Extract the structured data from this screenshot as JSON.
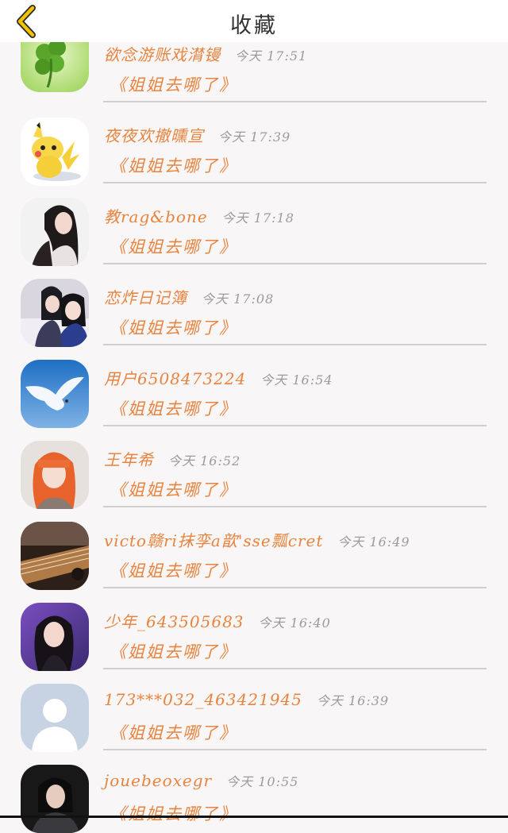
{
  "header": {
    "title": "收藏",
    "back_icon": "chevron-left-icon",
    "accent": "#f2c200"
  },
  "colors": {
    "name": "#e8843f",
    "time": "#9b9b9b",
    "background": "#f8f6f7"
  },
  "favorites": [
    {
      "name": "欲念游账戏潸镘",
      "day": "今天",
      "time": "17:51",
      "message": "《姐姐去哪了》",
      "avatar": "clover"
    },
    {
      "name": "夜夜欢撤曛宣",
      "day": "今天",
      "time": "17:39",
      "message": "《姐姐去哪了》",
      "avatar": "pikachu"
    },
    {
      "name": "教rag&bone",
      "day": "今天",
      "time": "17:18",
      "message": "《姐姐去哪了》",
      "avatar": "girl-dark-hair"
    },
    {
      "name": "恋炸日记簿",
      "day": "今天",
      "time": "17:08",
      "message": "《姐姐去哪了》",
      "avatar": "two-girls"
    },
    {
      "name": "用户6508473224",
      "day": "今天",
      "time": "16:54",
      "message": "《姐姐去哪了》",
      "avatar": "dove"
    },
    {
      "name": "王年希",
      "day": "今天",
      "time": "16:52",
      "message": "《姐姐去哪了》",
      "avatar": "orange-hair-girl"
    },
    {
      "name": "victo赣ri抹孪a歆'sse瓢cret",
      "day": "今天",
      "time": "16:49",
      "message": "《姐姐去哪了》",
      "avatar": "guzheng"
    },
    {
      "name": "少年_643505683",
      "day": "今天",
      "time": "16:40",
      "message": "《姐姐去哪了》",
      "avatar": "girl-purple"
    },
    {
      "name": "173***032_463421945",
      "day": "今天",
      "time": "16:39",
      "message": "《姐姐去哪了》",
      "avatar": "default-user"
    },
    {
      "name": "jouebeoxegr",
      "day": "今天",
      "time": "10:55",
      "message": "《姐姐去哪了》",
      "avatar": "warrior-girl"
    }
  ]
}
